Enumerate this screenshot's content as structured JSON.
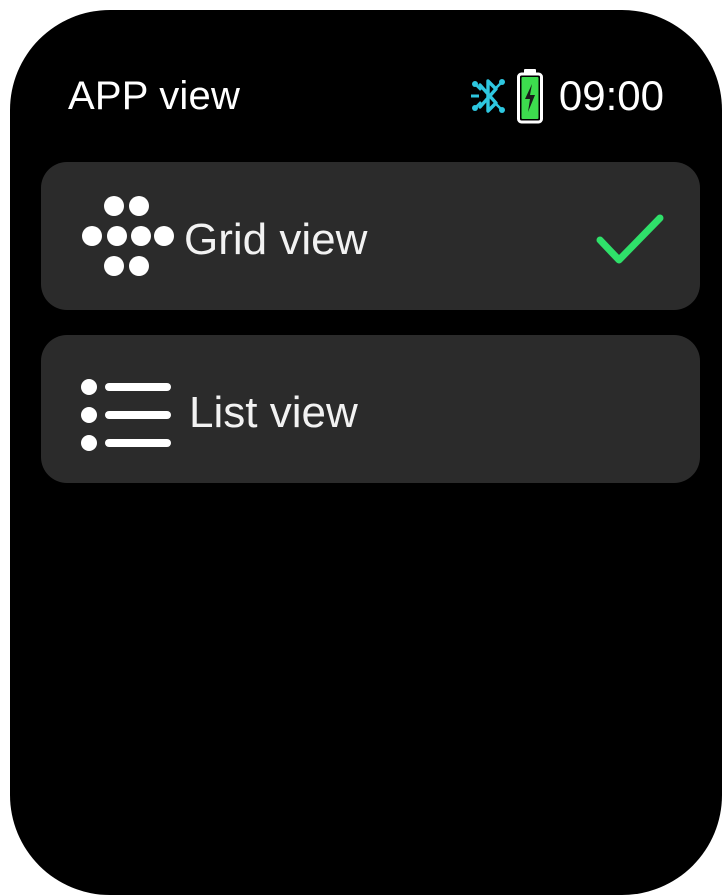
{
  "header": {
    "title": "APP view",
    "time": "09:00",
    "bluetooth_icon": "bluetooth-icon",
    "battery_icon": "battery-charging-icon",
    "accent_color": "#2ec7e0",
    "battery_color": "#3ddc4e"
  },
  "options": [
    {
      "label": "Grid view",
      "icon": "grid-view-icon",
      "selected": true
    },
    {
      "label": "List view",
      "icon": "list-view-icon",
      "selected": false
    }
  ],
  "selected_indicator": {
    "icon": "checkmark-icon",
    "color": "#2fe06a"
  }
}
